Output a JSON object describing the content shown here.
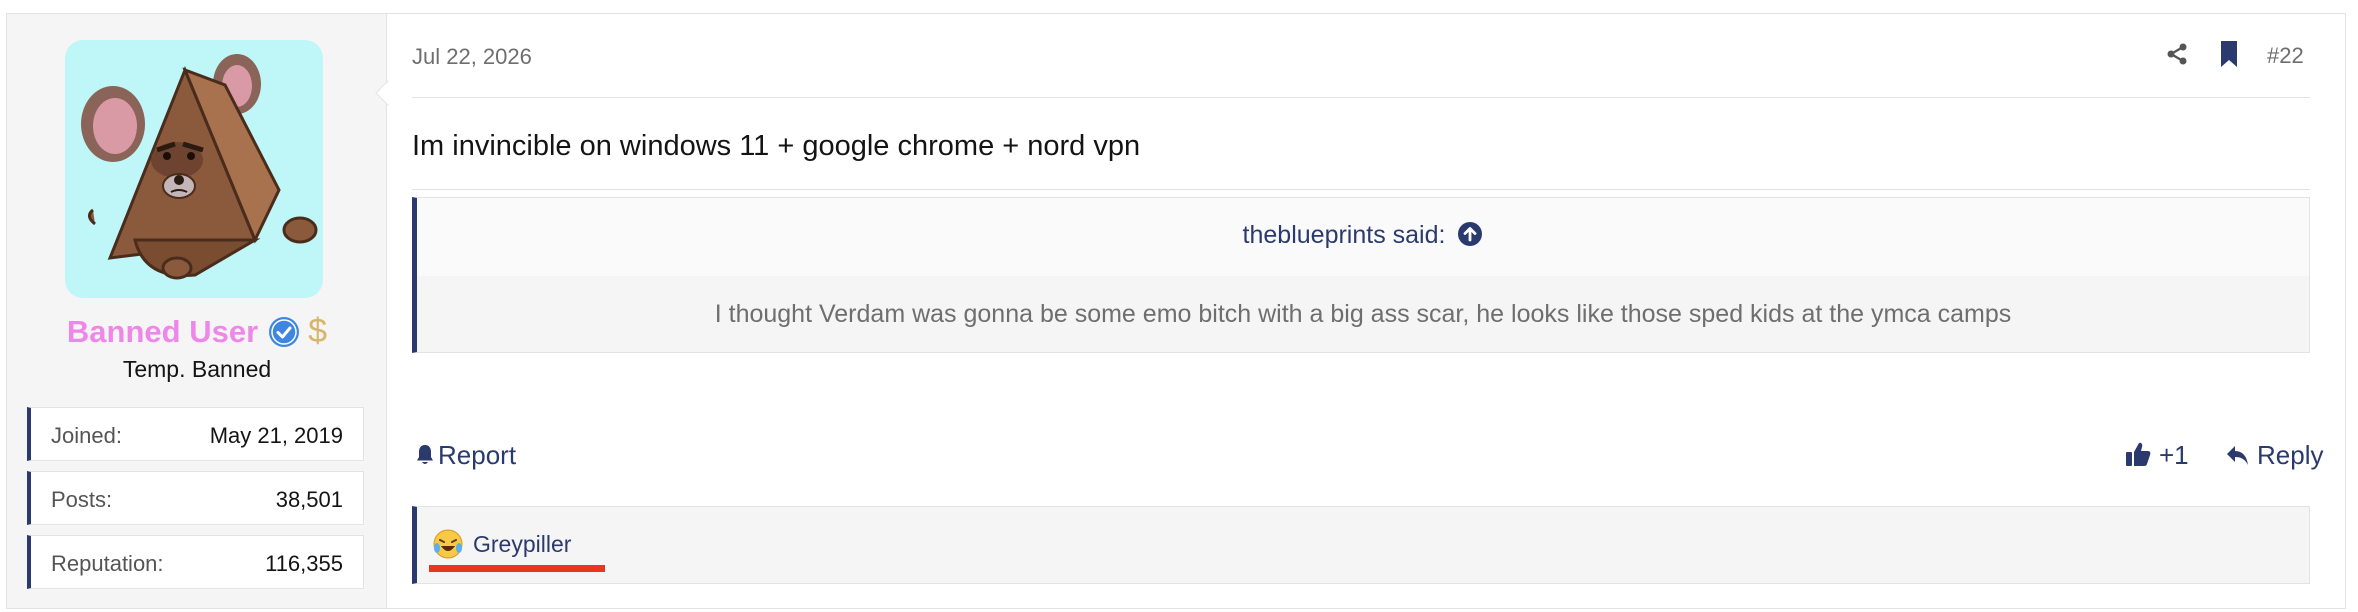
{
  "user": {
    "name": "Banned User",
    "title": "Temp. Banned",
    "badge_symbol": "$",
    "stats": [
      {
        "label": "Joined:",
        "value": "May 21, 2019"
      },
      {
        "label": "Posts:",
        "value": "38,501"
      },
      {
        "label": "Reputation:",
        "value": "116,355"
      }
    ]
  },
  "post": {
    "date": "Jul 22, 2026",
    "number": "#22",
    "text": "Im invincible on windows 11 + google chrome + nord vpn",
    "quote": {
      "author": "theblueprints said:",
      "text": "I thought Verdam was gonna be some emo bitch with a big ass scar, he looks like those sped kids at the ymca camps"
    },
    "actions": {
      "report": "Report",
      "like": "+1",
      "reply": "Reply"
    },
    "reactions": [
      {
        "emoji": "laughing-crying-icon",
        "user": "Greypiller"
      }
    ]
  },
  "icons": {
    "share": "share-icon",
    "bookmark": "bookmark-icon",
    "bell": "bell-icon",
    "thumbs_up": "thumbs-up-icon",
    "reply": "reply-arrow-icon",
    "verified": "verified-check-icon",
    "quote_jump": "arrow-up-circle-icon"
  },
  "colors": {
    "accent": "#2b3a6e",
    "username": "#ee88e8",
    "verified": "#3f86e0",
    "highlight": "#e8381c",
    "avatar_bg": "#bff7f9"
  }
}
